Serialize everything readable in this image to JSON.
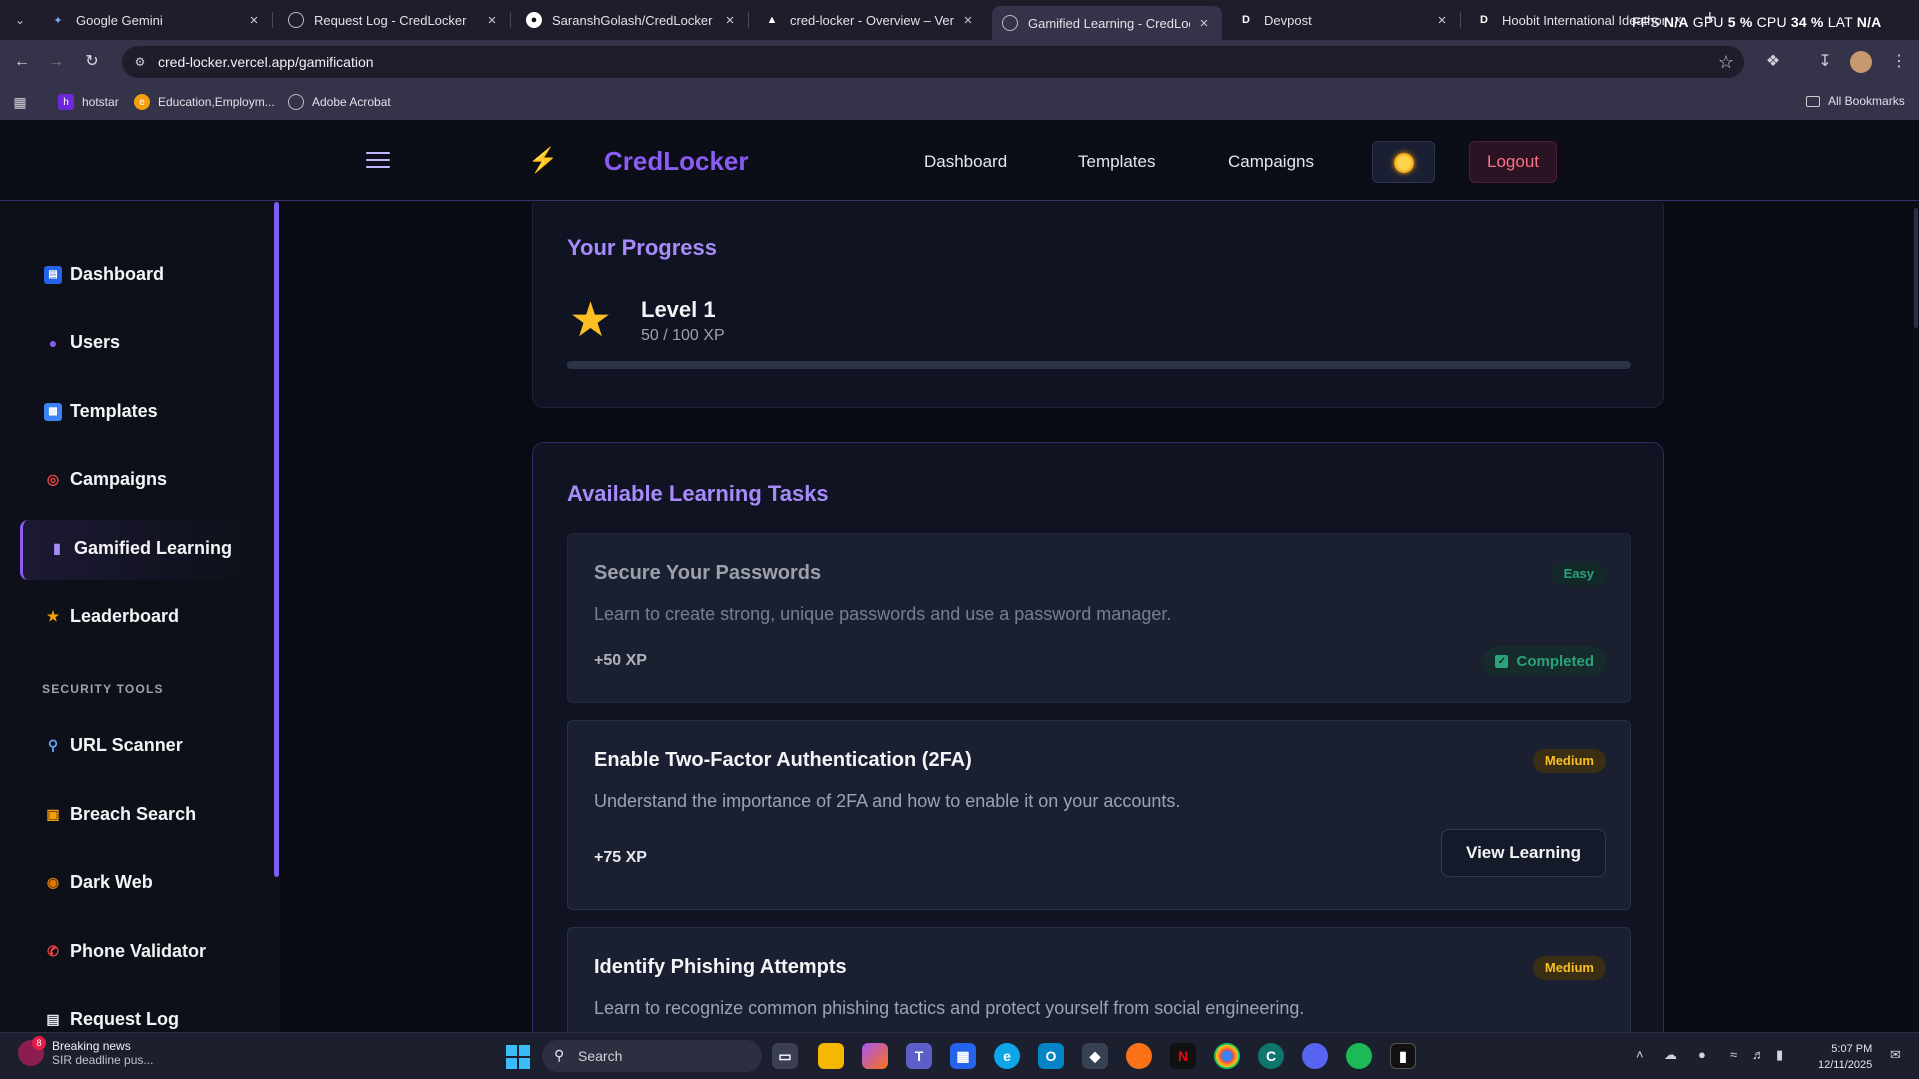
{
  "browser": {
    "tabs": [
      {
        "title": "Google Gemini",
        "favicon": "gemini-icon",
        "active": false
      },
      {
        "title": "Request Log - CredLocker",
        "favicon": "globe-icon",
        "active": false
      },
      {
        "title": "SaranshGolash/CredLocker",
        "favicon": "github-icon",
        "active": false
      },
      {
        "title": "cred-locker - Overview – Vercel",
        "favicon": "vercel-icon",
        "active": false
      },
      {
        "title": "Gamified Learning - CredLocker",
        "favicon": "globe-icon",
        "active": true
      },
      {
        "title": "Devpost",
        "favicon": "devpost-icon",
        "active": false
      },
      {
        "title": "Hoobit International Ideathon:",
        "favicon": "devpost-icon",
        "active": false
      }
    ],
    "perf_overlay": {
      "fps_label": "FPS",
      "fps_value": "N/A",
      "gpu_label": "GPU",
      "gpu_value": "5 %",
      "cpu_label": "CPU",
      "cpu_value": "34 %",
      "lat_label": "LAT",
      "lat_value": "N/A"
    },
    "url": "cred-locker.vercel.app/gamification",
    "bookmarks": [
      {
        "label": "hotstar"
      },
      {
        "label": "Education,Employm..."
      },
      {
        "label": "Adobe Acrobat"
      }
    ],
    "all_bookmarks": "All Bookmarks"
  },
  "header": {
    "brand": "CredLocker",
    "nav": [
      "Dashboard",
      "Templates",
      "Campaigns"
    ],
    "logout": "Logout"
  },
  "sidebar": {
    "items": [
      {
        "label": "Dashboard",
        "icon": "bar-chart-icon"
      },
      {
        "label": "Users",
        "icon": "users-icon"
      },
      {
        "label": "Templates",
        "icon": "template-icon"
      },
      {
        "label": "Campaigns",
        "icon": "target-icon"
      },
      {
        "label": "Gamified Learning",
        "icon": "game-controller-icon",
        "active": true
      },
      {
        "label": "Leaderboard",
        "icon": "trophy-icon"
      }
    ],
    "section_title": "SECURITY TOOLS",
    "tools": [
      {
        "label": "URL Scanner",
        "icon": "magnifier-icon"
      },
      {
        "label": "Breach Search",
        "icon": "lock-icon"
      },
      {
        "label": "Dark Web",
        "icon": "detective-icon"
      },
      {
        "label": "Phone Validator",
        "icon": "phone-icon"
      },
      {
        "label": "Request Log",
        "icon": "document-icon"
      }
    ]
  },
  "progress": {
    "title": "Your Progress",
    "level": "Level 1",
    "xp": "50 / 100 XP",
    "xp_fraction": 0.5
  },
  "tasks": {
    "title": "Available Learning Tasks",
    "items": [
      {
        "title": "Secure Your Passwords",
        "difficulty": "Easy",
        "description": "Learn to create strong, unique passwords and use a password manager.",
        "xp": "+50 XP",
        "status": "Completed"
      },
      {
        "title": "Enable Two-Factor Authentication (2FA)",
        "difficulty": "Medium",
        "description": "Understand the importance of 2FA and how to enable it on your accounts.",
        "xp": "+75 XP",
        "action": "View Learning"
      },
      {
        "title": "Identify Phishing Attempts",
        "difficulty": "Medium",
        "description": "Learn to recognize common phishing tactics and protect yourself from social engineering."
      }
    ]
  },
  "taskbar": {
    "news_count": "8",
    "news_title": "Breaking news",
    "news_sub": "SIR deadline pus...",
    "search": "Search",
    "time": "5:07 PM",
    "date": "12/11/2025"
  }
}
